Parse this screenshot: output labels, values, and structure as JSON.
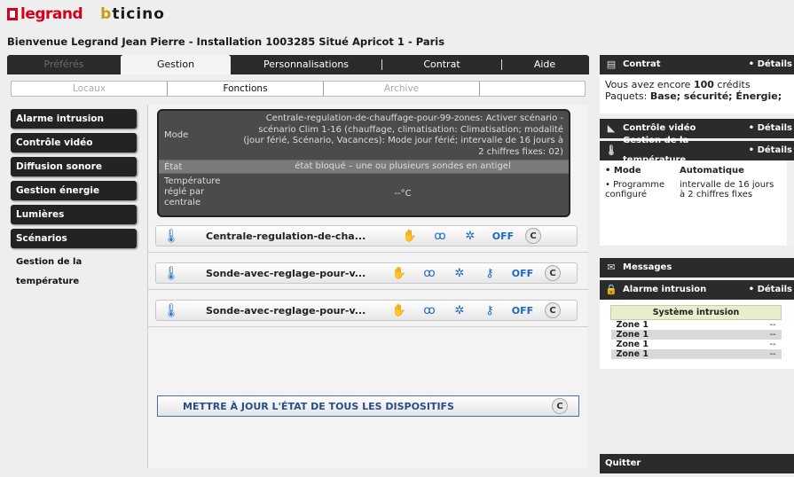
{
  "brand": {
    "legrand": "legrand",
    "bticino": "bticino"
  },
  "welcome": "Bienvenue Legrand Jean Pierre - Installation 1003285 Situé Apricot 1 - Paris",
  "topnav": [
    "Préférés",
    "Gestion",
    "Personnalisations",
    "Contrat",
    "Aide"
  ],
  "subnav": [
    "Locaux",
    "Fonctions",
    "Archive"
  ],
  "sidebar": [
    "Alarme intrusion",
    "Contrôle vidéo",
    "Diffusion sonore",
    "Gestion énergie",
    "Lumières",
    "Scénarios",
    "Gestion de la température"
  ],
  "status": {
    "mode_label": "Mode",
    "mode_value": "Centrale-regulation-de-chauffage-pour-99-zones: Activer scénario - scénario Clim 1-16 (chauffage, climatisation: Climatisation; modalité (jour férié, Scénario, Vacances): Mode jour férié; intervalle de 16 jours à 2 chiffres fixes: 02)",
    "etat_label": "État",
    "etat_value": "état bloqué – une ou plusieurs sondes en antigel",
    "temp_label": "Température réglé par centrale",
    "temp_value": "--°C"
  },
  "devices": [
    {
      "name": "Centrale-regulation-de-cha...",
      "off": "OFF"
    },
    {
      "name": "Sonde-avec-reglage-pour-v...",
      "off": "OFF"
    },
    {
      "name": "Sonde-avec-reglage-pour-v...",
      "off": "OFF"
    }
  ],
  "update_button": "METTRE À JOUR L'ÉTAT DE TOUS LES DISPOSITIFS",
  "right": {
    "contrat": {
      "title": "Contrat",
      "details": "• Détails",
      "line1_pre": "Vous avez encore ",
      "line1_bold": "100",
      "line1_post": " crédits",
      "line2_pre": "Paquets: ",
      "line2_bold": "Base; sécurité; Énergie;"
    },
    "video": {
      "title": "Contrôle vidéo",
      "details": "• Détails"
    },
    "temp": {
      "title": "Gestion de la température",
      "details": "• Détails",
      "mode_label": "• Mode",
      "mode_value": "Automatique",
      "prog_label": "• Programme configuré",
      "prog_value": "intervalle de 16 jours à 2 chiffres fixes"
    },
    "messages": {
      "title": "Messages"
    },
    "alarm": {
      "title": "Alarme intrusion",
      "details": "• Détails",
      "table_header": "Système intrusion",
      "zones": [
        {
          "zone": "Zone 1",
          "value": "--"
        },
        {
          "zone": "Zone 1",
          "value": "--"
        },
        {
          "zone": "Zone 1",
          "value": "--"
        },
        {
          "zone": "Zone 1",
          "value": "--"
        }
      ]
    },
    "quit": "Quitter"
  },
  "colors": {
    "accent_red": "#d6001c",
    "nav_dark": "#2b2b2b",
    "icon_blue": "#1f66c2"
  }
}
